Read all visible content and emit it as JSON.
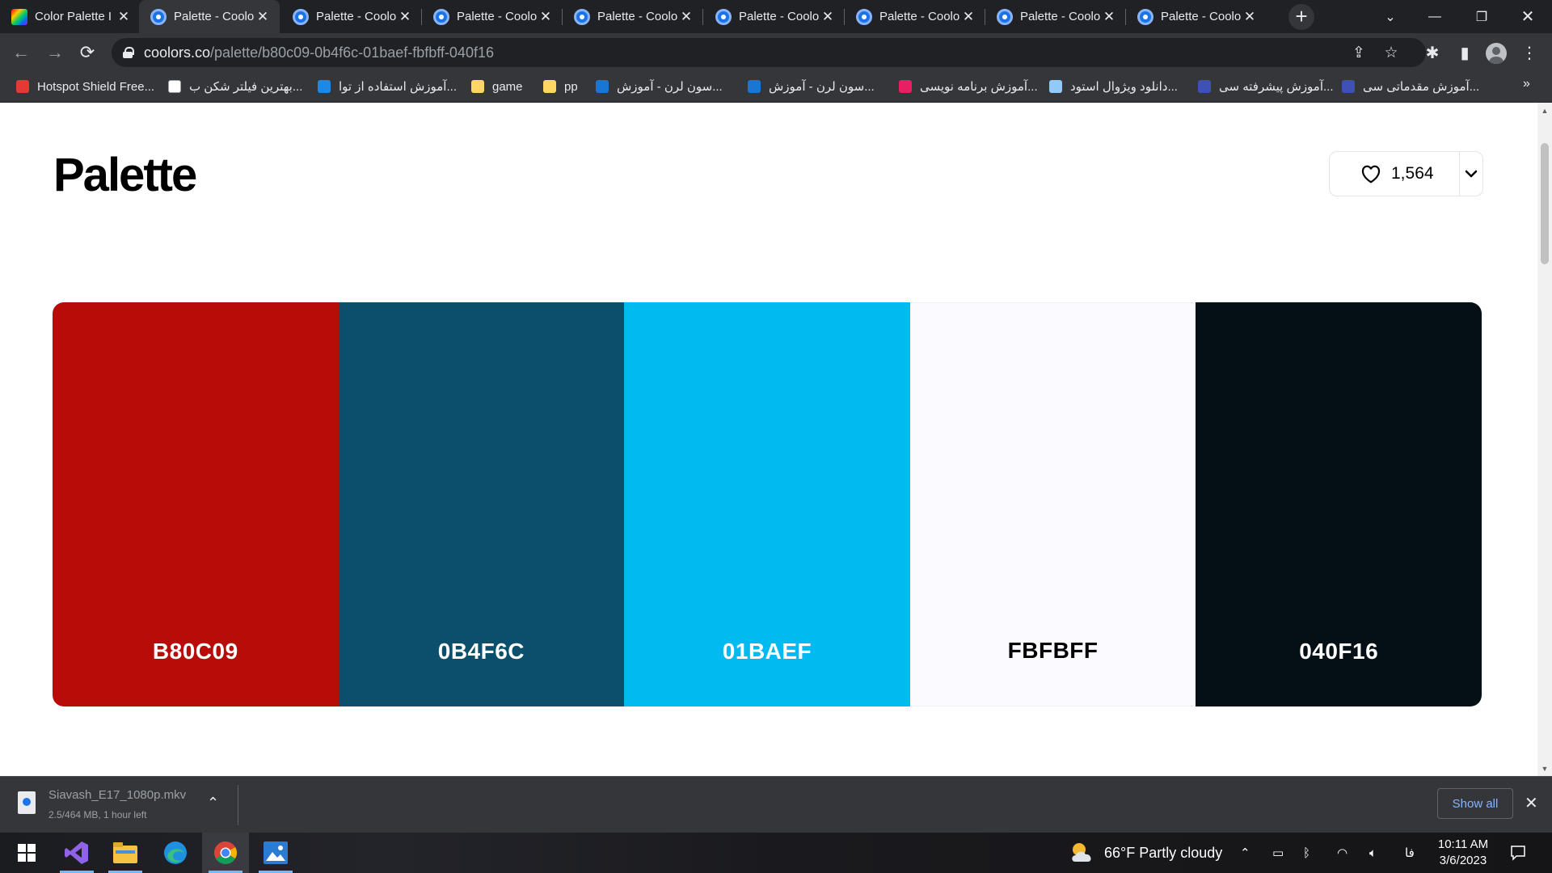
{
  "browser": {
    "tabs": [
      {
        "title": "Color Palette I",
        "favicon": "colorpalette-favicon",
        "active": false
      },
      {
        "title": "Palette - Coolo",
        "favicon": "coolors-favicon",
        "active": true
      },
      {
        "title": "Palette - Coolo",
        "favicon": "coolors-favicon",
        "active": false
      },
      {
        "title": "Palette - Coolo",
        "favicon": "coolors-favicon",
        "active": false
      },
      {
        "title": "Palette - Coolo",
        "favicon": "coolors-favicon",
        "active": false
      },
      {
        "title": "Palette - Coolo",
        "favicon": "coolors-favicon",
        "active": false
      },
      {
        "title": "Palette - Coolo",
        "favicon": "coolors-favicon",
        "active": false
      },
      {
        "title": "Palette - Coolo",
        "favicon": "coolors-favicon",
        "active": false
      },
      {
        "title": "Palette - Coolo",
        "favicon": "coolors-favicon",
        "active": false
      }
    ],
    "url_host": "coolors.co",
    "url_path": "/palette/b80c09-0b4f6c-01baef-fbfbff-040f16"
  },
  "bookmarks": [
    {
      "label": "Hotspot Shield Free...",
      "icon": "hotspot-icon",
      "color": "#e53935"
    },
    {
      "label": "بهترین فیلتر شکن ب...",
      "icon": "google-icon",
      "color": "#ffffff"
    },
    {
      "label": "آموزش استفاده از توا...",
      "icon": "site-icon",
      "color": "#1e88e5"
    },
    {
      "label": "game",
      "icon": "folder-icon",
      "color": "#fdd663"
    },
    {
      "label": "pp",
      "icon": "folder-icon",
      "color": "#fdd663"
    },
    {
      "label": "سون لرن - آموزش...",
      "icon": "sevenlearn-icon",
      "color": "#1976d2"
    },
    {
      "label": "سون لرن - آموزش...",
      "icon": "sevenlearn-icon",
      "color": "#1976d2"
    },
    {
      "label": "آموزش برنامه نویسی...",
      "icon": "site-icon",
      "color": "#e91e63"
    },
    {
      "label": "دانلود ویژوال استود...",
      "icon": "site-icon",
      "color": "#90caf9"
    },
    {
      "label": "آموزش پیشرفته سی...",
      "icon": "site-icon",
      "color": "#3f51b5"
    },
    {
      "label": "آموزش مقدماتی سی...",
      "icon": "site-icon",
      "color": "#3f51b5"
    }
  ],
  "page": {
    "title": "Palette",
    "likes": "1,564",
    "swatches": [
      {
        "hex": "B80C09",
        "color": "#B80C09",
        "text_color": "#ffffff"
      },
      {
        "hex": "0B4F6C",
        "color": "#0B4F6C",
        "text_color": "#ffffff"
      },
      {
        "hex": "01BAEF",
        "color": "#01BAEF",
        "text_color": "#ffffff"
      },
      {
        "hex": "FBFBFF",
        "color": "#FBFBFF",
        "text_color": "#000000"
      },
      {
        "hex": "040F16",
        "color": "#040F16",
        "text_color": "#ffffff"
      }
    ]
  },
  "download": {
    "filename": "Siavash_E17_1080p.mkv",
    "status": "2.5/464 MB, 1 hour left",
    "show_all": "Show all"
  },
  "taskbar": {
    "apps": [
      "visual-studio-icon",
      "file-explorer-icon",
      "edge-icon",
      "chrome-icon",
      "photos-icon"
    ],
    "weather": "66°F  Partly cloudy",
    "language": "فا",
    "time": "10:11 AM",
    "date": "3/6/2023"
  }
}
